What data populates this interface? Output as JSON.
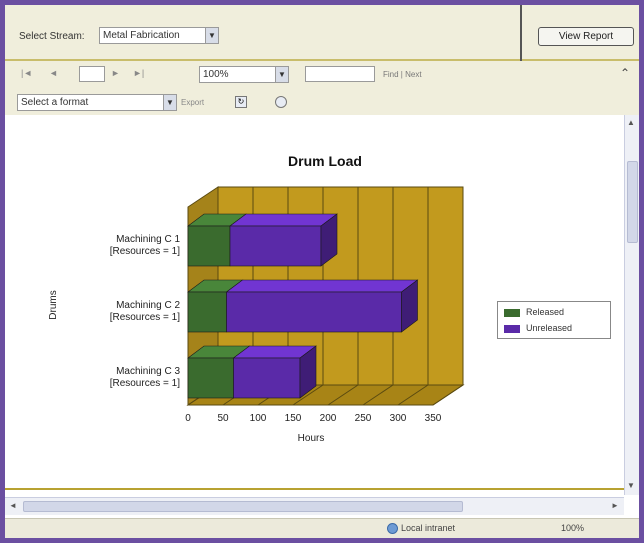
{
  "params": {
    "select_stream_label": "Select Stream:",
    "stream_value": "Metal Fabrication",
    "view_report_label": "View Report"
  },
  "toolbar": {
    "first_page": "|◄",
    "prev_page": "◄",
    "page_value": "",
    "next_page": "►",
    "last_page": "►|",
    "zoom_value": "100%",
    "find_value": "",
    "find_label": "Find",
    "next_label": "Next",
    "export_format": "Select a format",
    "export_label": "Export"
  },
  "status": {
    "zone_label": "Local intranet",
    "zoom_label": "100%"
  },
  "colors": {
    "released": "#3a6b2e",
    "unreleased": "#5a2aa8",
    "wall": "#c29a1e",
    "floor": "#a88416"
  },
  "chart_data": {
    "type": "bar",
    "orientation": "horizontal",
    "stacked": true,
    "title": "Drum Load",
    "xlabel": "Hours",
    "ylabel": "Drums",
    "categories": [
      "Machining C 1\n[Resources = 1]",
      "Machining C 2\n[Resources = 1]",
      "Machining C 3\n[Resources = 1]"
    ],
    "category_lines": [
      [
        "Machining C 1",
        "[Resources = 1]"
      ],
      [
        "Machining C 2",
        "[Resources = 1]"
      ],
      [
        "Machining C 3",
        "[Resources = 1]"
      ]
    ],
    "series": [
      {
        "name": "Released",
        "values": [
          60,
          55,
          65
        ],
        "color": "#3a6b2e"
      },
      {
        "name": "Unreleased",
        "values": [
          130,
          250,
          95
        ],
        "color": "#5a2aa8"
      }
    ],
    "xticks": [
      "0",
      "50",
      "100",
      "150",
      "200",
      "250",
      "300",
      "350"
    ],
    "xlim": [
      0,
      350
    ],
    "grid": true,
    "legend_position": "right"
  }
}
